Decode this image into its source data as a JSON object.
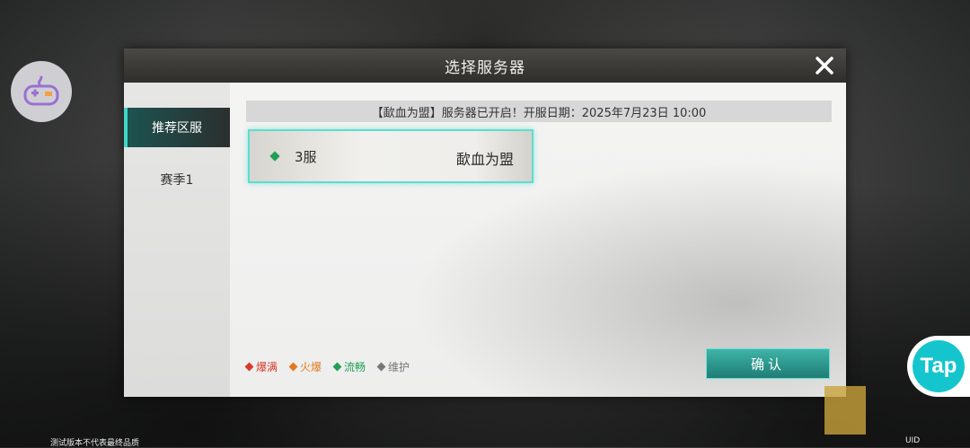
{
  "dialog": {
    "title": "选择服务器",
    "close_icon": "close-icon"
  },
  "sidebar": {
    "items": [
      {
        "label": "推荐区服",
        "active": true
      },
      {
        "label": "赛季1",
        "active": false
      }
    ]
  },
  "notice": {
    "text": "【歃血为盟】服务器已开启！开服日期：2025年7月23日 10:00"
  },
  "servers": [
    {
      "name": "3服",
      "title": "歃血为盟",
      "status_color": "#1fa055"
    }
  ],
  "legend": [
    {
      "label": "爆满",
      "color": "#d93a2f"
    },
    {
      "label": "火爆",
      "color": "#e07a1f"
    },
    {
      "label": "流畅",
      "color": "#1fa055"
    },
    {
      "label": "维护",
      "color": "#777777"
    }
  ],
  "confirm_label": "确认",
  "footer": {
    "note": "测试版本不代表最终品质",
    "uid": "UID"
  },
  "overlay": {
    "tap_label": "Tap"
  }
}
